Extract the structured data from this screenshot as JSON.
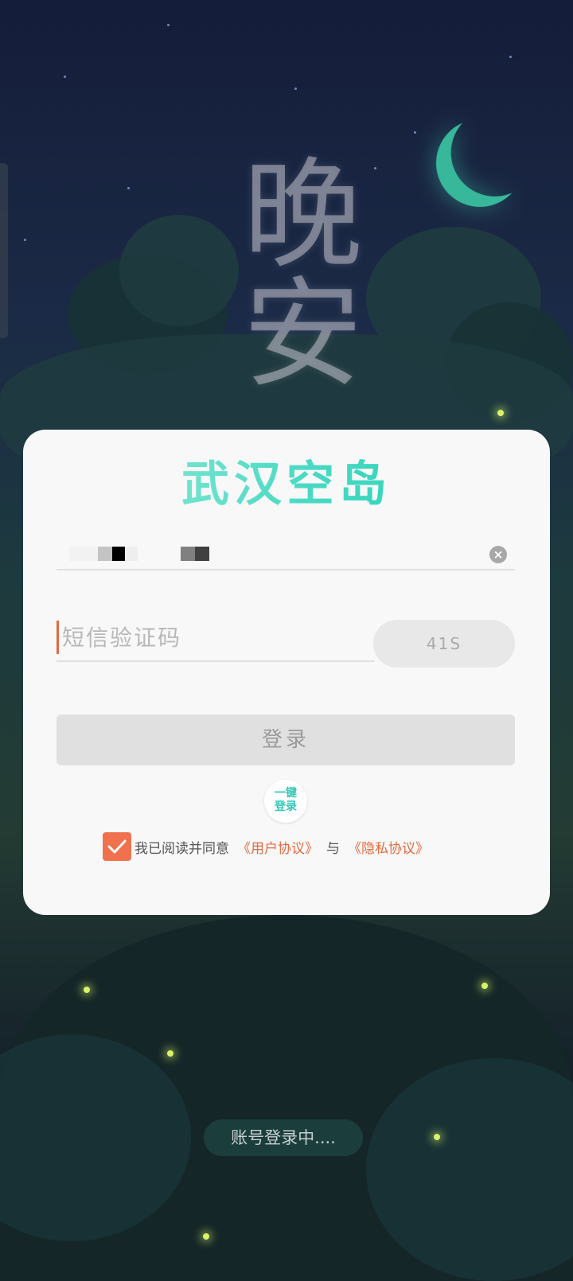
{
  "background": {
    "night_title": "晚安"
  },
  "login": {
    "brand": "武汉空岛",
    "code_placeholder": "短信验证码",
    "countdown": "41S",
    "login_button": "登录",
    "one_key_line1": "一键",
    "one_key_line2": "登录",
    "agreement": {
      "checked": true,
      "prefix": "我已阅读并同意",
      "user_agreement": "《用户协议》",
      "connector": "与",
      "privacy_policy": "《隐私协议》"
    }
  },
  "status": {
    "text": "账号登录中...."
  },
  "colors": {
    "accent": "#2fc6b4",
    "link": "#e36a40",
    "checkbox": "#f0714d"
  }
}
